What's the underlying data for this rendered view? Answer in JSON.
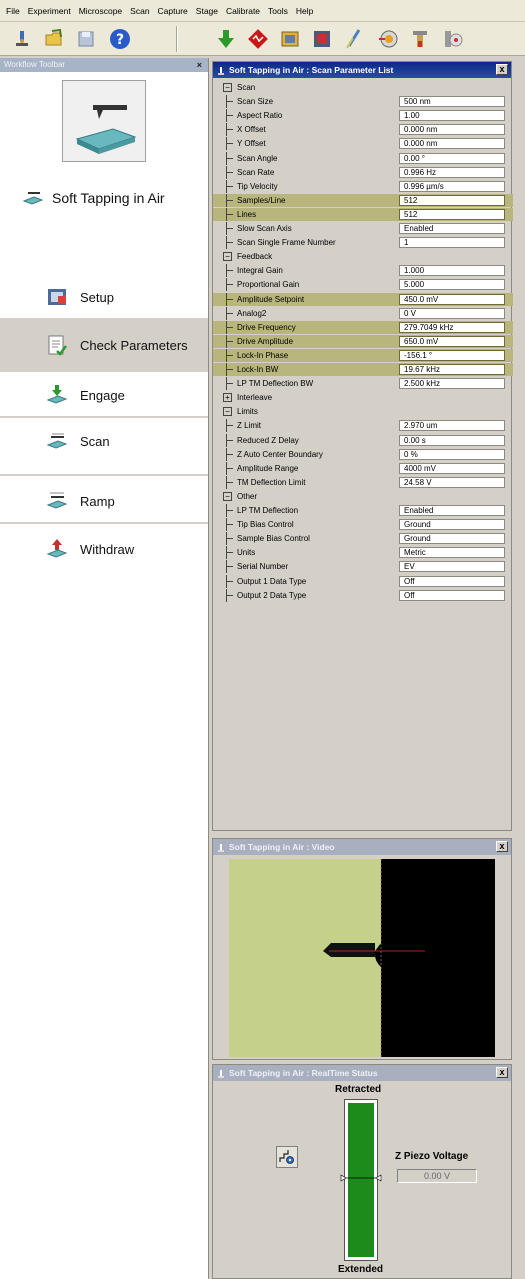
{
  "menu": [
    "File",
    "Experiment",
    "Microscope",
    "Scan",
    "Capture",
    "Stage",
    "Calibrate",
    "Tools",
    "Help"
  ],
  "toolbar": {
    "icons": [
      "microscope-icon",
      "open-folder-icon",
      "save-icon",
      "help-icon",
      "engage-icon",
      "realtime-icon",
      "capture-icon",
      "offline-icon",
      "probe-icon",
      "laser-align-icon",
      "thermal-tune-icon",
      "tune-icon"
    ]
  },
  "workflow": {
    "title": "Workflow Toolbar",
    "close": "×",
    "mode": "Soft Tapping in Air",
    "steps": [
      {
        "name": "setup",
        "label": "Setup",
        "icon": "setup-icon"
      },
      {
        "name": "check-parameters",
        "label": "Check Parameters",
        "icon": "check-parameters-icon"
      },
      {
        "name": "engage",
        "label": "Engage",
        "icon": "engage-step-icon"
      },
      {
        "name": "scan",
        "label": "Scan",
        "icon": "scan-step-icon"
      },
      {
        "name": "ramp",
        "label": "Ramp",
        "icon": "ramp-step-icon"
      },
      {
        "name": "withdraw",
        "label": "Withdraw",
        "icon": "withdraw-step-icon"
      }
    ]
  },
  "param_panel": {
    "title": "Soft Tapping in Air : Scan Parameter List",
    "close": "x",
    "rows": [
      {
        "type": "group",
        "label": "Scan",
        "expander": "−"
      },
      {
        "type": "param",
        "label": "Scan Size",
        "value": "500 nm"
      },
      {
        "type": "param",
        "label": "Aspect Ratio",
        "value": "1.00"
      },
      {
        "type": "param",
        "label": "X Offset",
        "value": "0.000 nm"
      },
      {
        "type": "param",
        "label": "Y Offset",
        "value": "0.000 nm"
      },
      {
        "type": "param",
        "label": "Scan Angle",
        "value": "0.00 °"
      },
      {
        "type": "param",
        "label": "Scan Rate",
        "value": "0.996 Hz"
      },
      {
        "type": "param",
        "label": "Tip Velocity",
        "value": "0.996 µm/s"
      },
      {
        "type": "param",
        "label": "Samples/Line",
        "value": "512",
        "hl": true
      },
      {
        "type": "param",
        "label": "Lines",
        "value": "512",
        "hl": true
      },
      {
        "type": "param",
        "label": "Slow Scan Axis",
        "value": "Enabled"
      },
      {
        "type": "param",
        "label": "Scan Single Frame Number",
        "value": "1"
      },
      {
        "type": "group",
        "label": "Feedback",
        "expander": "−"
      },
      {
        "type": "param",
        "label": "Integral Gain",
        "value": "1.000"
      },
      {
        "type": "param",
        "label": "Proportional Gain",
        "value": "5.000"
      },
      {
        "type": "param",
        "label": "Amplitude Setpoint",
        "value": "450.0 mV",
        "hl": true
      },
      {
        "type": "param",
        "label": "Analog2",
        "value": "0 V"
      },
      {
        "type": "param",
        "label": "Drive Frequency",
        "value": "279.7049 kHz",
        "hl": true
      },
      {
        "type": "param",
        "label": "Drive Amplitude",
        "value": "650.0 mV",
        "hl": true
      },
      {
        "type": "param",
        "label": "Lock-In Phase",
        "value": "-156.1 °",
        "hl": true
      },
      {
        "type": "param",
        "label": "Lock-In BW",
        "value": "19.67 kHz",
        "hl": true
      },
      {
        "type": "param",
        "label": "LP TM Deflection BW",
        "value": "2.500 kHz"
      },
      {
        "type": "group",
        "label": "Interleave",
        "expander": "+"
      },
      {
        "type": "group",
        "label": "Limits",
        "expander": "−"
      },
      {
        "type": "param",
        "label": "Z Limit",
        "value": "2.970 um"
      },
      {
        "type": "param",
        "label": "Reduced Z Delay",
        "value": "0.00 s"
      },
      {
        "type": "param",
        "label": "Z Auto Center Boundary",
        "value": "0 %"
      },
      {
        "type": "param",
        "label": "Amplitude Range",
        "value": "4000 mV"
      },
      {
        "type": "param",
        "label": "TM Deflection Limit",
        "value": "24.58 V"
      },
      {
        "type": "group",
        "label": "Other",
        "expander": "−"
      },
      {
        "type": "param",
        "label": "LP TM Deflection",
        "value": "Enabled"
      },
      {
        "type": "param",
        "label": "Tip Bias Control",
        "value": "Ground"
      },
      {
        "type": "param",
        "label": "Sample Bias Control",
        "value": "Ground"
      },
      {
        "type": "param",
        "label": "Units",
        "value": "Metric"
      },
      {
        "type": "param",
        "label": "Serial Number",
        "value": "EV"
      },
      {
        "type": "param",
        "label": "Output 1 Data Type",
        "value": "Off"
      },
      {
        "type": "param",
        "label": "Output 2 Data Type",
        "value": "Off"
      }
    ]
  },
  "video_panel": {
    "title": "Soft Tapping in Air : Video",
    "close": "x"
  },
  "realtime_panel": {
    "title": "Soft Tapping in Air : RealTime Status",
    "close": "x",
    "retracted_label": "Retracted",
    "extended_label": "Extended",
    "z_piezo_label": "Z Piezo Voltage",
    "z_piezo_value": "0.00 V",
    "z_level_fraction": 1.0
  },
  "colors": {
    "highlight": "#b8b67d",
    "title_active": "#0c2a84",
    "bar_green": "#1c8b1c",
    "video_bg": "#c5d18a"
  }
}
